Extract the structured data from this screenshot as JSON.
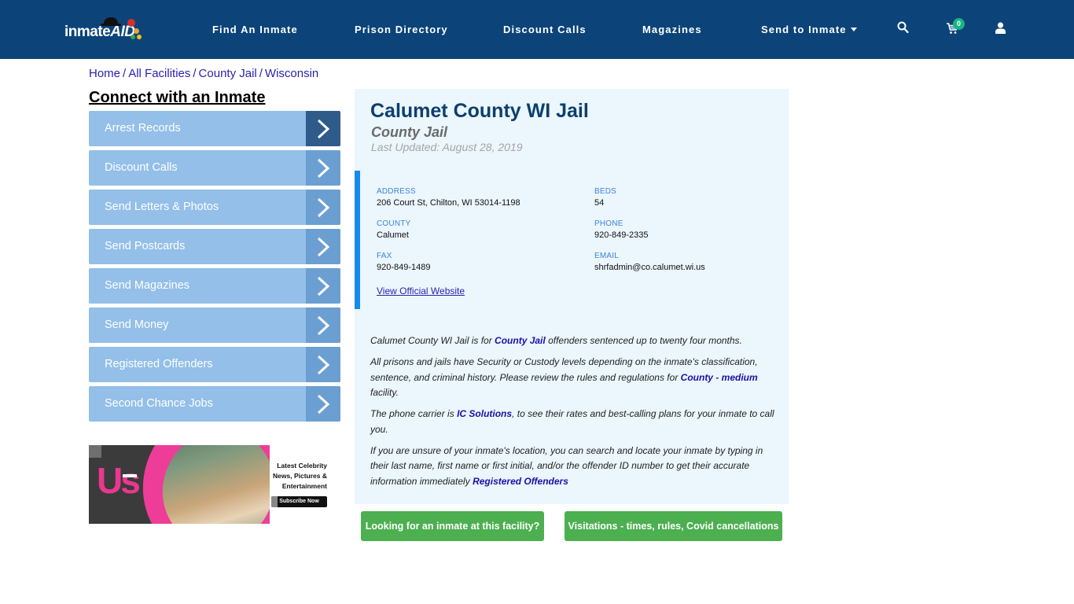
{
  "header": {
    "logo_text": "inmate",
    "logo_text_accent": "AID",
    "nav": [
      {
        "label": "Find An Inmate"
      },
      {
        "label": "Prison Directory"
      },
      {
        "label": "Discount Calls"
      },
      {
        "label": "Magazines"
      },
      {
        "label": "Send to Inmate",
        "has_dropdown": true
      }
    ],
    "icons": {
      "search": "search-icon",
      "cart": "cart-icon",
      "user": "user-icon"
    },
    "cart_count": "0"
  },
  "breadcrumb": [
    {
      "label": "Home"
    },
    {
      "label": "All Facilities"
    },
    {
      "label": "County Jail"
    },
    {
      "label": "Wisconsin"
    }
  ],
  "breadcrumb_separator": "/",
  "sidebar": {
    "title": "Connect with an Inmate",
    "items": [
      {
        "label": "Arrest Records"
      },
      {
        "label": "Discount Calls"
      },
      {
        "label": "Send Letters & Photos"
      },
      {
        "label": "Send Postcards"
      },
      {
        "label": "Send Magazines"
      },
      {
        "label": "Send Money"
      },
      {
        "label": "Registered Offenders"
      },
      {
        "label": "Second Chance Jobs"
      }
    ],
    "ad": {
      "brand": "Us",
      "line1": "Latest Celebrity",
      "line2": "News, Pictures &",
      "line3": "Entertainment",
      "cta": "Subscribe Now"
    }
  },
  "facility": {
    "name": "Calumet County WI Jail",
    "type": "County Jail",
    "last_updated": "Last Updated: August 28, 2019",
    "fields": {
      "address": {
        "label": "ADDRESS",
        "value": "206 Court St, Chilton, WI 53014-1198"
      },
      "beds": {
        "label": "BEDS",
        "value": "54"
      },
      "county": {
        "label": "COUNTY",
        "value": "Calumet"
      },
      "phone": {
        "label": "PHONE",
        "value": "920-849-2335"
      },
      "fax": {
        "label": "FAX",
        "value": "920-849-1489"
      },
      "email": {
        "label": "EMAIL",
        "value": "shrfadmin@co.calumet.wi.us"
      }
    },
    "website_link": "View Official Website",
    "description": {
      "p1_a": "Calumet County WI Jail is for ",
      "p1_link": "County Jail",
      "p1_b": " offenders sentenced up to twenty four months.",
      "p2_a": "All prisons and jails have Security or Custody levels depending on the inmate's classification, sentence, and criminal history. Please review the rules and regulations for ",
      "p2_link": "County - medium",
      "p2_b": " facility.",
      "p3_a": "The phone carrier is ",
      "p3_link": "IC Solutions",
      "p3_b": ", to see their rates and best-calling plans for your inmate to call you.",
      "p4_a": "If you are unsure of your inmate's location, you can search and locate your inmate by typing in their last name, first name or first initial, and/or the offender ID number to get their accurate information immediately ",
      "p4_link": "Registered Offenders"
    },
    "buttons": {
      "find_inmate": "Looking for an inmate at this facility?",
      "visitations": "Visitations - times, rules, Covid cancellations"
    }
  },
  "colors": {
    "header_bg": "#0c4479",
    "sidebar_item": "#93bfe9",
    "sidebar_arrow": "#6b9fd2",
    "sidebar_arrow_active": "#2f5b8a",
    "panel_bg": "#ebf6fd",
    "accent_bar": "#1689ec",
    "title": "#0c3f6e",
    "button_green": "#4caf50",
    "badge": "#1bb385"
  }
}
